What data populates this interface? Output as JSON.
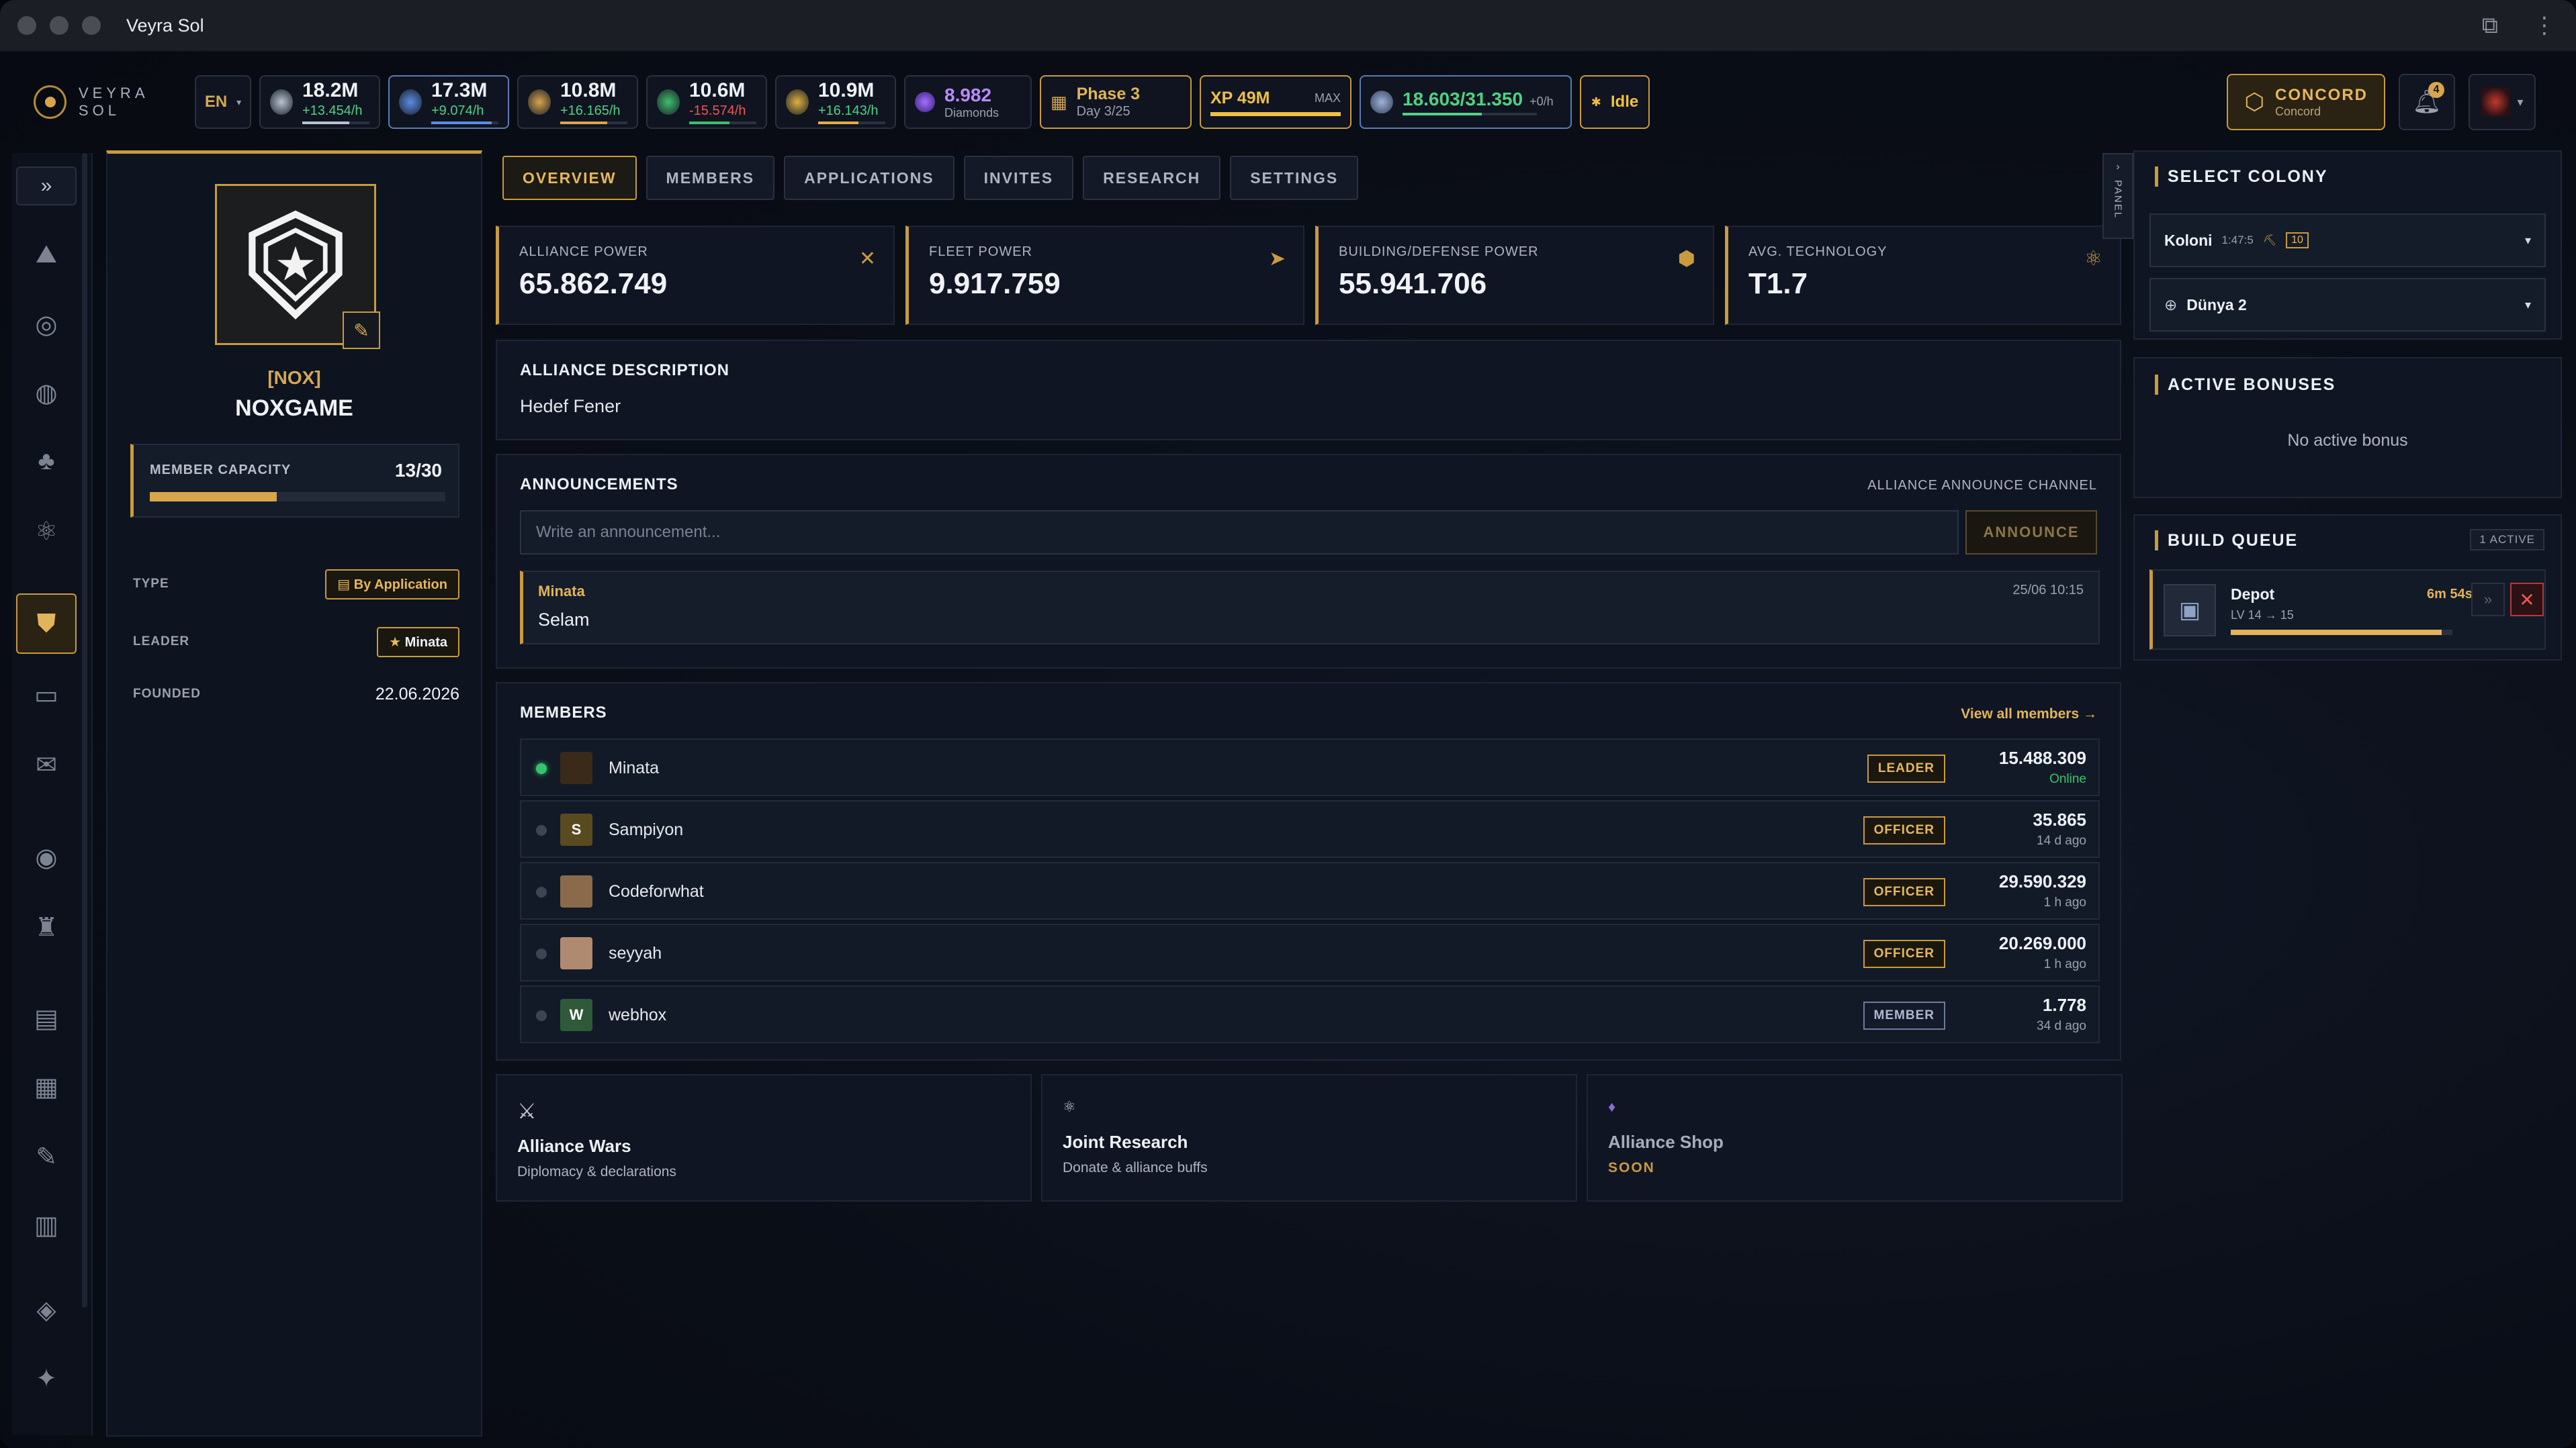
{
  "window": {
    "title": "Veyra Sol"
  },
  "brand": {
    "name": "VEYRA SOL"
  },
  "hud": {
    "language": "EN",
    "resources": [
      {
        "name": "metal",
        "value": "18.2M",
        "rate": "+13.454/h",
        "negative": false,
        "color": "#b9c2d0",
        "fill": 0.7
      },
      {
        "name": "crystal",
        "value": "17.3M",
        "rate": "+9.074/h",
        "negative": false,
        "color": "#5b8de6",
        "fill": 0.9
      },
      {
        "name": "fuel",
        "value": "10.8M",
        "rate": "+16.165/h",
        "negative": false,
        "color": "#d9a54a",
        "fill": 0.7
      },
      {
        "name": "bio",
        "value": "10.6M",
        "rate": "-15.574/h",
        "negative": true,
        "color": "#3fbf6b",
        "fill": 0.6
      },
      {
        "name": "gold",
        "value": "10.9M",
        "rate": "+16.143/h",
        "negative": false,
        "color": "#e0b040",
        "fill": 0.6
      }
    ],
    "diamonds": {
      "value": "8.982",
      "label": "Diamonds"
    },
    "phase": {
      "title": "Phase 3",
      "day": "Day 3/25"
    },
    "xp": {
      "value": "XP 49M",
      "max": "MAX"
    },
    "population": {
      "value": "18.603/31.350",
      "rate": "+0/h"
    },
    "status": "Idle",
    "faction": {
      "name": "CONCORD",
      "sub": "Concord"
    },
    "notifications": "4"
  },
  "profile": {
    "tag": "[NOX]",
    "name": "NOXGAME",
    "capacity_label": "MEMBER CAPACITY",
    "capacity_value": "13/30",
    "capacity_fill": 0.43,
    "type_label": "TYPE",
    "type_value": "By Application",
    "leader_label": "LEADER",
    "leader_value": "Minata",
    "founded_label": "FOUNDED",
    "founded_value": "22.06.2026"
  },
  "tabs": [
    "OVERVIEW",
    "MEMBERS",
    "APPLICATIONS",
    "INVITES",
    "RESEARCH",
    "SETTINGS"
  ],
  "stats": [
    {
      "label": "ALLIANCE POWER",
      "value": "65.862.749",
      "icon": "swords-icon"
    },
    {
      "label": "FLEET POWER",
      "value": "9.917.759",
      "icon": "ship-icon"
    },
    {
      "label": "BUILDING/DEFENSE POWER",
      "value": "55.941.706",
      "icon": "hexagon-icon"
    },
    {
      "label": "AVG. TECHNOLOGY",
      "value": "T1.7",
      "icon": "atom-icon"
    }
  ],
  "description": {
    "title": "ALLIANCE DESCRIPTION",
    "text": "Hedef Fener"
  },
  "announcements": {
    "title": "ANNOUNCEMENTS",
    "channel": "ALLIANCE ANNOUNCE CHANNEL",
    "placeholder": "Write an announcement...",
    "button": "ANNOUNCE",
    "messages": [
      {
        "author": "Minata",
        "time": "25/06 10:15",
        "body": "Selam"
      }
    ]
  },
  "members": {
    "title": "MEMBERS",
    "view_all": "View all members →",
    "rows": [
      {
        "name": "Minata",
        "role": "LEADER",
        "power": "15.488.309",
        "status": "Online",
        "online": true,
        "initial": "",
        "avatar_color": "#3a2a1a"
      },
      {
        "name": "Sampiyon",
        "role": "OFFICER",
        "power": "35.865",
        "status": "14 d ago",
        "online": false,
        "initial": "S",
        "avatar_color": "#5a4a1f"
      },
      {
        "name": "Codeforwhat",
        "role": "OFFICER",
        "power": "29.590.329",
        "status": "1 h ago",
        "online": false,
        "initial": "",
        "avatar_color": "#8a6a4a"
      },
      {
        "name": "seyyah",
        "role": "OFFICER",
        "power": "20.269.000",
        "status": "1 h ago",
        "online": false,
        "initial": "",
        "avatar_color": "#b08a70"
      },
      {
        "name": "webhox",
        "role": "MEMBER",
        "power": "1.778",
        "status": "34 d ago",
        "online": false,
        "initial": "W",
        "avatar_color": "#2f5a3a"
      }
    ]
  },
  "features": [
    {
      "title": "Alliance Wars",
      "sub": "Diplomacy & declarations",
      "icon": "crossed-swords-icon"
    },
    {
      "title": "Joint Research",
      "sub": "Donate & alliance buffs",
      "icon": "atom-icon"
    },
    {
      "title": "Alliance Shop",
      "sub": "SOON",
      "icon": "gem-icon"
    }
  ],
  "panel_tab": "PANEL",
  "colony": {
    "title": "SELECT COLONY",
    "colony_name": "Koloni",
    "colony_coords": "1:47:5",
    "colony_level": "10",
    "planet": "Dünya 2"
  },
  "bonuses": {
    "title": "ACTIVE BONUSES",
    "empty": "No active bonus"
  },
  "build_queue": {
    "title": "BUILD QUEUE",
    "active": "1 ACTIVE",
    "items": [
      {
        "name": "Depot",
        "level": "LV 14 → 15",
        "time": "6m 54s",
        "progress": 0.95
      }
    ]
  }
}
